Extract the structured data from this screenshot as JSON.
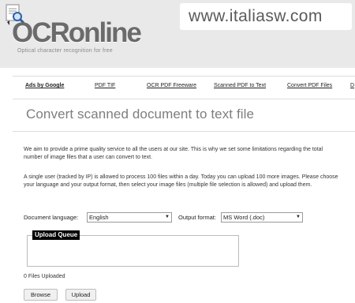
{
  "brand": {
    "logo_text": "OCRonline",
    "tagline": "Optical character recognition for free",
    "watermark": "www.italiasw.com"
  },
  "nav": {
    "items": [
      {
        "label": "Ads by Google"
      },
      {
        "label": "PDF TIF"
      },
      {
        "label": "OCR PDF Freeware"
      },
      {
        "label": "Scanned PDF to Text"
      },
      {
        "label": "Convert PDF Files"
      },
      {
        "label": "D"
      }
    ]
  },
  "main": {
    "title": "Convert scanned document to text file",
    "intro": "We aim to provide a prime quality service to all the users at our site. This is why we set some limitations regarding the total number of image files that a user can convert to text.",
    "limit": "A single user (tracked by IP) is allowed to process 100 files within a day. Today you can upload 100 more images. Please choose your language and your output format, then select your image files (multiple file selection is allowed) and upload them."
  },
  "form": {
    "language_label": "Document language:",
    "language_value": "English",
    "format_label": "Output format:",
    "format_value": "MS Word (.doc)"
  },
  "upload": {
    "queue_title": "Upload Queue",
    "files_uploaded": "0 Files Uploaded",
    "browse_label": "Browse",
    "upload_label": "Upload"
  },
  "icons": {
    "logo": "document-magnifier-icon",
    "dropdown": "chevron-down-icon"
  }
}
